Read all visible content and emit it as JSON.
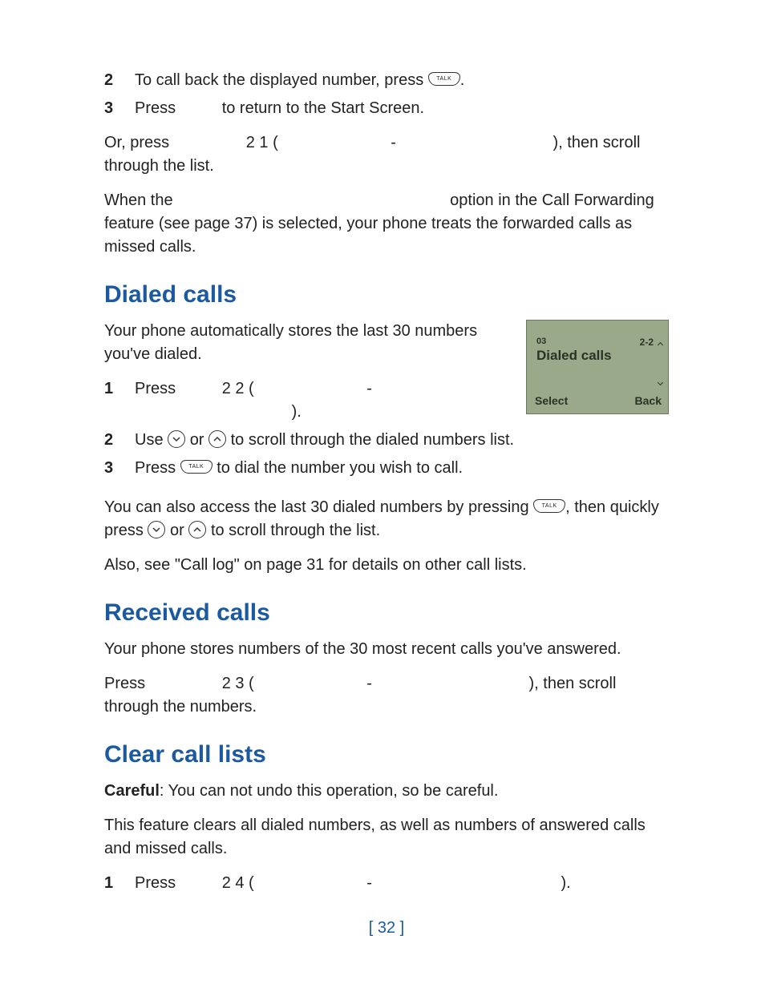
{
  "intro": {
    "step2_num": "2",
    "step2_text_a": "To call back the displayed number, press ",
    "step2_text_b": ".",
    "step3_num": "3",
    "step3_text_a": "Press",
    "step3_text_b": "to return to the Start Screen.",
    "or_a": "Or, press",
    "or_b": "2 1 (",
    "or_c": "-",
    "or_d": "), then scroll through the list.",
    "when_a": "When the",
    "when_b": "option in the Call Forwarding feature (see page 37) is selected, your phone treats the forwarded calls as missed calls."
  },
  "dialed": {
    "heading": "Dialed calls",
    "intro": "Your phone automatically stores the last 30 numbers you've dialed.",
    "s1_num": "1",
    "s1_a": "Press",
    "s1_b": "2 2 (",
    "s1_c": "-",
    "s1_d": ").",
    "s2_num": "2",
    "s2_a": "Use ",
    "s2_b": " or ",
    "s2_c": " to scroll through the dialed numbers list.",
    "s3_num": "3",
    "s3_a": "Press ",
    "s3_b": " to dial the number you wish to call.",
    "p2_a": "You can also access the last 30 dialed numbers by pressing ",
    "p2_b": ", then quickly press ",
    "p2_c": " or ",
    "p2_d": " to scroll through the list.",
    "p3": "Also, see \"Call log\" on page 31 for details on other call lists."
  },
  "screen": {
    "line1": "03",
    "title": "Dialed calls",
    "tr": "2-2",
    "select": "Select",
    "back": "Back"
  },
  "received": {
    "heading": "Received calls",
    "intro": "Your phone stores numbers of the 30 most recent calls you've answered.",
    "p_a": "Press",
    "p_b": "2 3 (",
    "p_c": "-",
    "p_d": "), then scroll through the numbers."
  },
  "clear": {
    "heading": "Clear call lists",
    "careful_label": "Careful",
    "careful_text": ": You can not undo this operation, so be careful.",
    "intro": "This feature clears all dialed numbers, as well as numbers of answered calls and missed calls.",
    "s1_num": "1",
    "s1_a": "Press",
    "s1_b": "2 4 (",
    "s1_c": "-",
    "s1_d": ")."
  },
  "talk_label": "TALK",
  "page_number": "[ 32 ]"
}
